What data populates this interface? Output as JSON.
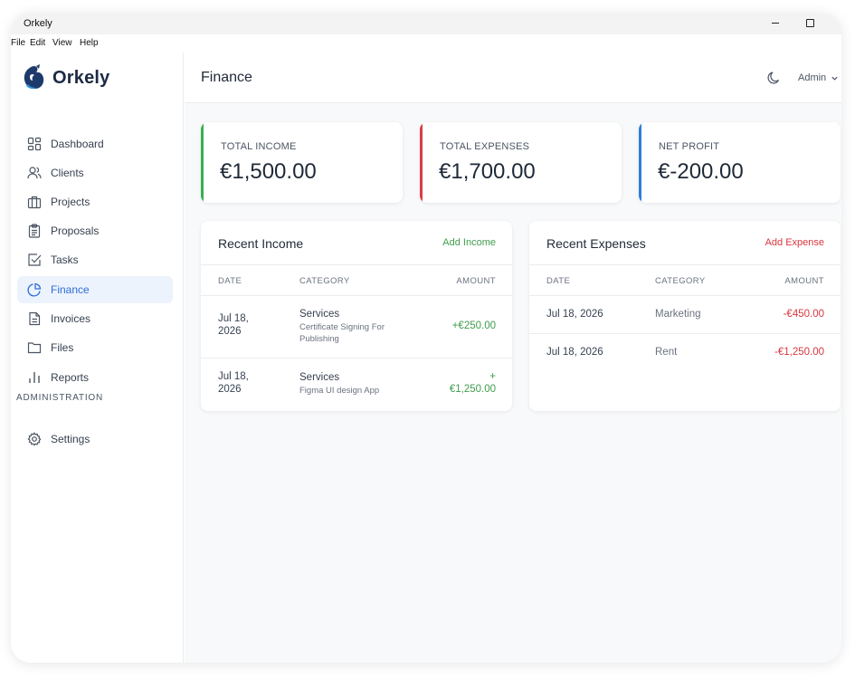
{
  "window": {
    "title": "Orkely"
  },
  "menu": [
    "File",
    "Edit",
    "View",
    "Help"
  ],
  "brand": {
    "name": "Orkely",
    "accent": "#2c6fd9"
  },
  "sidebar": {
    "items": [
      {
        "label": "Dashboard",
        "icon": "dashboard-icon"
      },
      {
        "label": "Clients",
        "icon": "users-icon"
      },
      {
        "label": "Projects",
        "icon": "briefcase-icon"
      },
      {
        "label": "Proposals",
        "icon": "clipboard-icon"
      },
      {
        "label": "Tasks",
        "icon": "checkbox-icon"
      },
      {
        "label": "Finance",
        "icon": "pie-chart-icon",
        "active": true
      },
      {
        "label": "Invoices",
        "icon": "document-icon"
      },
      {
        "label": "Files",
        "icon": "folder-icon"
      },
      {
        "label": "Reports",
        "icon": "bar-chart-icon"
      }
    ],
    "section_label": "ADMINISTRATION",
    "admin_items": [
      {
        "label": "Settings",
        "icon": "gear-icon"
      }
    ]
  },
  "header": {
    "title": "Finance",
    "user": "Admin"
  },
  "stats": [
    {
      "label": "TOTAL INCOME",
      "value": "€1,500.00",
      "color": "#3aae52"
    },
    {
      "label": "TOTAL EXPENSES",
      "value": "€1,700.00",
      "color": "#dc3c44"
    },
    {
      "label": "NET PROFIT",
      "value": "€-200.00",
      "color": "#2f7ddc"
    }
  ],
  "income": {
    "title": "Recent Income",
    "action": "Add Income",
    "columns": [
      "DATE",
      "CATEGORY",
      "AMOUNT"
    ],
    "rows": [
      {
        "date_line1": "Jul 18,",
        "date_line2": "2026",
        "category": "Services",
        "desc_line1": "Certificate Signing For",
        "desc_line2": "Publishing",
        "amount": "+€250.00"
      },
      {
        "date_line1": "Jul 18,",
        "date_line2": "2026",
        "category": "Services",
        "desc_line1": "Figma UI design App",
        "amount_line1": "+",
        "amount_line2": "€1,250.00"
      }
    ]
  },
  "expenses": {
    "title": "Recent Expenses",
    "action": "Add Expense",
    "columns": [
      "DATE",
      "CATEGORY",
      "AMOUNT"
    ],
    "rows": [
      {
        "date": "Jul 18, 2026",
        "category": "Marketing",
        "amount": "-€450.00"
      },
      {
        "date": "Jul 18, 2026",
        "category": "Rent",
        "amount": "-€1,250.00"
      }
    ]
  },
  "colors": {
    "income_green": "#3f9b4b",
    "expense_red": "#d9363e",
    "active_bg": "#edf3fd"
  }
}
